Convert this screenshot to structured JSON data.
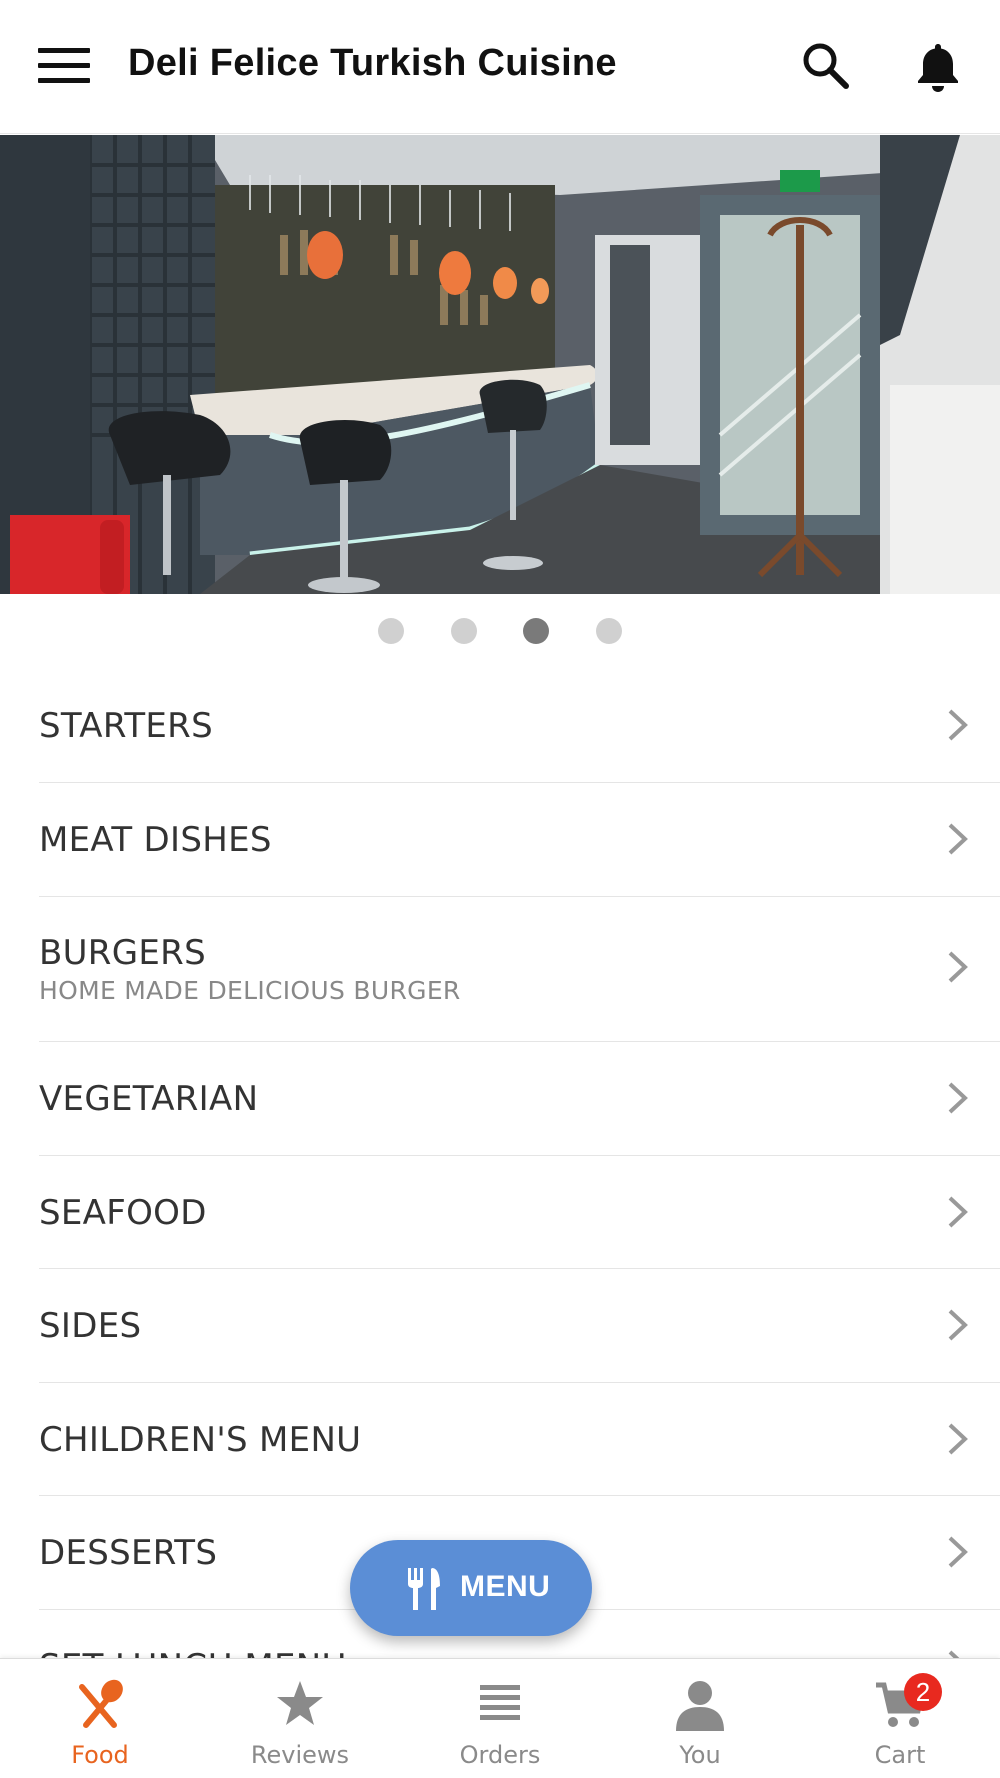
{
  "header": {
    "title": "Deli Felice Turkish Cuisine",
    "menu_icon": "hamburger-menu-icon",
    "search_icon": "search-icon",
    "notification_icon": "bell-icon"
  },
  "carousel": {
    "slide_count": 4,
    "active_index": 2
  },
  "categories": [
    {
      "name": "STARTERS",
      "subtitle": ""
    },
    {
      "name": "MEAT DISHES",
      "subtitle": ""
    },
    {
      "name": "BURGERS",
      "subtitle": "HOME MADE DELICIOUS BURGER"
    },
    {
      "name": "VEGETARIAN",
      "subtitle": ""
    },
    {
      "name": "SEAFOOD",
      "subtitle": ""
    },
    {
      "name": "SIDES",
      "subtitle": ""
    },
    {
      "name": "CHILDREN'S MENU",
      "subtitle": ""
    },
    {
      "name": "DESSERTS",
      "subtitle": ""
    },
    {
      "name": "SET LUNCH MENU",
      "subtitle": ""
    }
  ],
  "fab": {
    "label": "MENU",
    "icon": "fork-knife-icon"
  },
  "tabs": [
    {
      "label": "Food",
      "icon": "food-icon",
      "active": true
    },
    {
      "label": "Reviews",
      "icon": "star-icon",
      "active": false
    },
    {
      "label": "Orders",
      "icon": "list-icon",
      "active": false
    },
    {
      "label": "You",
      "icon": "person-icon",
      "active": false
    },
    {
      "label": "Cart",
      "icon": "cart-icon",
      "active": false,
      "badge": "2"
    }
  ],
  "colors": {
    "accent": "#e8641f",
    "fab": "#5b8ed6",
    "badge": "#e8291f",
    "inactive": "#8a8a8a"
  }
}
